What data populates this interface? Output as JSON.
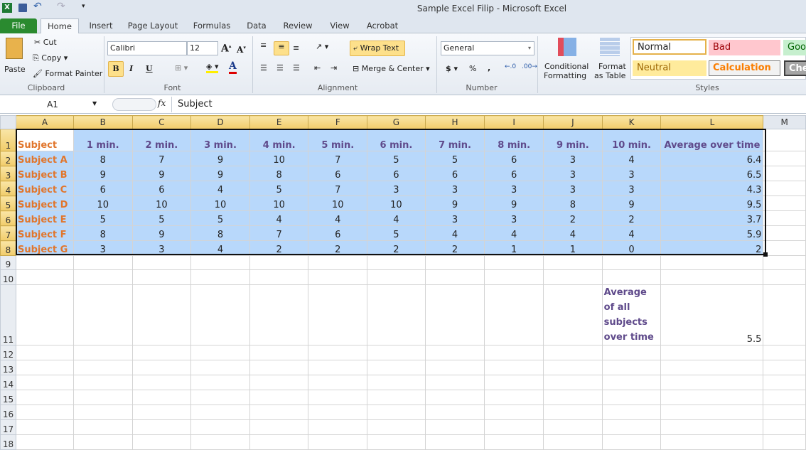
{
  "window": {
    "title": "Sample Excel Filip  -  Microsoft Excel"
  },
  "tabs": [
    "File",
    "Home",
    "Insert",
    "Page Layout",
    "Formulas",
    "Data",
    "Review",
    "View",
    "Acrobat"
  ],
  "clipboard": {
    "paste": "Paste",
    "cut": "Cut",
    "copy": "Copy",
    "format_painter": "Format Painter",
    "label": "Clipboard"
  },
  "font": {
    "name": "Calibri",
    "size": "12",
    "bold": "B",
    "italic": "I",
    "underline": "U",
    "label": "Font"
  },
  "alignment": {
    "wrap": "Wrap Text",
    "merge": "Merge & Center",
    "label": "Alignment"
  },
  "number": {
    "format": "General",
    "currency": "$",
    "percent": "%",
    "comma": ",",
    "label": "Number"
  },
  "styles": {
    "conditional": "Conditional",
    "conditional2": "Formatting",
    "format_table": "Format",
    "format_table2": "as Table",
    "label": "Styles",
    "cells": [
      {
        "label": "Normal",
        "color": "#000000"
      },
      {
        "label": "Bad",
        "color": "#9c0006"
      },
      {
        "label": "Goo",
        "color": "#006100"
      },
      {
        "label": "Neutral",
        "color": "#9c6500"
      },
      {
        "label": "Calculation",
        "color": "#fa7d00"
      },
      {
        "label": "Chec",
        "color": "#ffffff"
      }
    ]
  },
  "formula_bar": {
    "name_box": "A1",
    "fx": "fx",
    "value": "Subject"
  },
  "columns": [
    "A",
    "B",
    "C",
    "D",
    "E",
    "F",
    "G",
    "H",
    "I",
    "J",
    "K",
    "L",
    "M"
  ],
  "sheet": {
    "header": [
      "Subject",
      "1 min.",
      "2 min.",
      "3 min.",
      "4 min.",
      "5 min.",
      "6 min.",
      "7 min.",
      "8 min.",
      "9 min.",
      "10 min.",
      "Average over time"
    ],
    "rows": [
      [
        "Subject A",
        "8",
        "7",
        "9",
        "10",
        "7",
        "5",
        "5",
        "6",
        "3",
        "4",
        "6.4"
      ],
      [
        "Subject B",
        "9",
        "9",
        "9",
        "8",
        "6",
        "6",
        "6",
        "6",
        "3",
        "3",
        "6.5"
      ],
      [
        "Subject C",
        "6",
        "6",
        "4",
        "5",
        "7",
        "3",
        "3",
        "3",
        "3",
        "3",
        "4.3"
      ],
      [
        "Subject D",
        "10",
        "10",
        "10",
        "10",
        "10",
        "10",
        "9",
        "9",
        "8",
        "9",
        "9.5"
      ],
      [
        "Subject E",
        "5",
        "5",
        "5",
        "4",
        "4",
        "4",
        "3",
        "3",
        "2",
        "2",
        "3.7"
      ],
      [
        "Subject F",
        "8",
        "9",
        "8",
        "7",
        "6",
        "5",
        "4",
        "4",
        "4",
        "4",
        "5.9"
      ],
      [
        "Subject G",
        "3",
        "3",
        "4",
        "2",
        "2",
        "2",
        "2",
        "1",
        "1",
        "0",
        "2"
      ]
    ],
    "summary_label": "Average of all subjects over time",
    "summary_value": "5.5"
  },
  "row_numbers": [
    "1",
    "2",
    "3",
    "4",
    "5",
    "6",
    "7",
    "8",
    "9",
    "10",
    "11",
    "12",
    "13",
    "14",
    "15",
    "16",
    "17",
    "18"
  ]
}
